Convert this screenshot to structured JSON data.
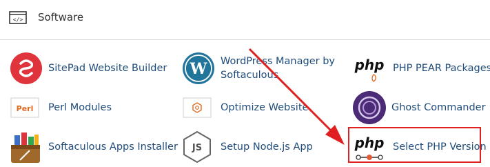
{
  "section": {
    "title": "Software",
    "icon": "code-window-icon"
  },
  "apps": [
    {
      "label": "SitePad Website Builder",
      "icon": "sitepad-icon"
    },
    {
      "label": "WordPress Manager by Softaculous",
      "icon": "wordpress-icon"
    },
    {
      "label": "PHP PEAR Packages",
      "icon": "php-pear-icon"
    },
    {
      "label": "Perl Modules",
      "icon": "perl-icon"
    },
    {
      "label": "Optimize Website",
      "icon": "optimize-website-icon"
    },
    {
      "label": "Ghost Commander",
      "icon": "ghost-commander-icon"
    },
    {
      "label": "Softaculous Apps Installer",
      "icon": "softaculous-icon"
    },
    {
      "label": "Setup Node.js App",
      "icon": "nodejs-icon"
    },
    {
      "label": "Select PHP Version",
      "icon": "select-php-version-icon"
    }
  ],
  "icon_text": {
    "php": "php",
    "perl": "Perl",
    "js": "JS"
  },
  "colors": {
    "link": "#1f4c7a",
    "highlight": "#e02020",
    "sitepad": "#e0343c",
    "wordpress": "#21759b",
    "ghost": "#4b2a76"
  }
}
